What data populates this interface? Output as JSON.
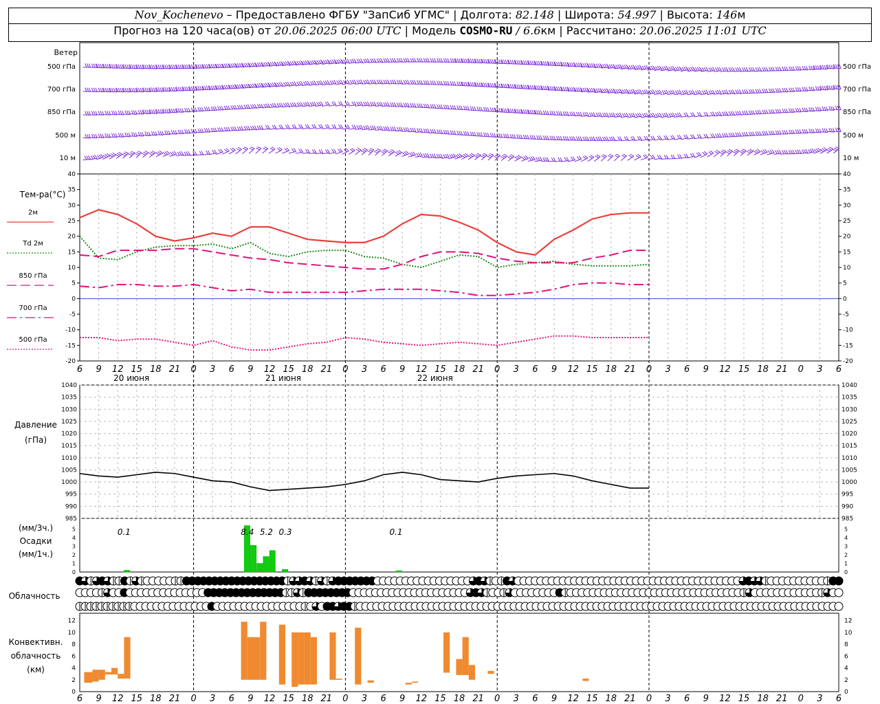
{
  "header": {
    "station": "Nov_Kochenevo",
    "provider": " – Предоставлено ФГБУ \"ЗапСиб УГМС\" | Долгота: ",
    "lon": "82.148",
    "lat_label": " | Широта: ",
    "lat": "54.997",
    "alt_label": " | Высота: ",
    "alt": "146",
    "alt_unit": "м",
    "forecast_prefix": "Прогноз на 120 часа(ов) от ",
    "forecast_time": "20.06.2025 06:00 UTC",
    "model_prefix": " | Модель ",
    "model": "COSMO-RU",
    "model_res": " / 6.6",
    "model_res_unit": "км",
    "calc_prefix": " | Рассчитано: ",
    "calc_time": "20.06.2025 11:01 UTC"
  },
  "chart_data": [
    {
      "type": "wind-barbs",
      "title": "Ветер",
      "levels": [
        "500 гПа",
        "700 гПа",
        "850 гПа",
        "500 м",
        "10  м"
      ],
      "color": "#7b2ad9"
    },
    {
      "type": "line",
      "title": "Тем-ра(°C)",
      "ylim": [
        -20,
        40
      ],
      "yticks": [
        40,
        35,
        30,
        25,
        20,
        15,
        10,
        5,
        0,
        -5,
        -10,
        -15,
        -20
      ],
      "x": [
        6,
        9,
        12,
        15,
        18,
        21,
        24,
        27,
        30,
        33,
        36,
        39,
        42,
        45,
        48,
        51,
        54,
        57,
        60,
        63,
        66,
        69,
        72,
        75,
        78,
        81,
        84,
        87,
        90,
        93,
        96,
        99,
        102,
        105,
        108,
        111,
        114,
        117,
        120,
        123,
        126
      ],
      "series": [
        {
          "name": "2м",
          "color": "#e8403a",
          "style": "solid",
          "values": [
            26,
            28.5,
            27,
            24,
            20,
            18.5,
            19.5,
            21,
            20,
            23,
            23,
            21,
            19,
            18.5,
            18,
            18,
            20,
            24,
            27,
            26.5,
            24.5,
            22,
            18,
            15,
            14,
            19,
            22,
            25.5,
            27,
            27.5,
            27.5
          ]
        },
        {
          "name": "Td  2м",
          "color": "#1a8c1a",
          "style": "dotted",
          "values": [
            20,
            13,
            12.5,
            15,
            16.5,
            17,
            17,
            17.5,
            16,
            18,
            14.5,
            13.5,
            15,
            15.5,
            15.5,
            13.5,
            13,
            11,
            10,
            12,
            14,
            13.5,
            10,
            11,
            11.5,
            12,
            11,
            10.5,
            10.5,
            10.5,
            11
          ]
        },
        {
          "name": "850 гПа",
          "color": "#e0107a",
          "style": "dashed",
          "values": [
            14,
            13.5,
            15.5,
            15.5,
            15.5,
            16,
            16,
            15,
            14,
            13,
            12.5,
            11.5,
            11,
            10.5,
            10,
            9.5,
            9.5,
            11,
            13.5,
            15,
            15,
            14.5,
            13,
            12,
            11.5,
            11.5,
            11.5,
            13,
            14,
            15.5,
            15.5
          ]
        },
        {
          "name": "700 гПа",
          "color": "#e0107a",
          "style": "dashdot",
          "values": [
            4,
            3.5,
            4.5,
            4.5,
            4,
            4,
            4.5,
            3.5,
            2.5,
            3,
            2,
            2,
            2,
            2,
            2,
            2.5,
            3,
            3,
            3,
            2.5,
            2,
            1,
            1,
            1.5,
            2,
            3,
            4.5,
            5,
            5,
            4.5,
            4.5
          ]
        },
        {
          "name": "500 гПа",
          "color": "#e0107a",
          "style": "dotted",
          "values": [
            -12.5,
            -12.5,
            -13.5,
            -13,
            -13,
            -14,
            -15,
            -13.5,
            -15.5,
            -16.5,
            -16.5,
            -15.5,
            -14.5,
            -14,
            -12.5,
            -13,
            -14,
            -14.5,
            -15,
            -14.5,
            -14,
            -14.5,
            -15,
            -14,
            -13,
            -12,
            -12,
            -12.5,
            -12.5,
            -12.5,
            -12.5
          ]
        }
      ],
      "x_ticks": [
        "6",
        "9",
        "12",
        "15",
        "18",
        "21",
        "0",
        "3",
        "6",
        "9",
        "12",
        "15",
        "18",
        "21",
        "0",
        "3",
        "6",
        "9",
        "12",
        "15",
        "18",
        "21",
        "0",
        "3",
        "6",
        "9",
        "12"
      ],
      "day_labels": [
        "20 июня",
        "21 июня",
        "22 июня"
      ]
    },
    {
      "type": "line",
      "title": "Давление",
      "unit": "(гПа)",
      "ylim": [
        985,
        1040
      ],
      "yticks": [
        1040,
        1035,
        1030,
        1025,
        1020,
        1015,
        1010,
        1005,
        1000,
        995,
        990,
        985
      ],
      "series": [
        {
          "name": "Давление",
          "color": "#000000",
          "values": [
            1003.5,
            1002.5,
            1002,
            1003,
            1004,
            1003.5,
            1002,
            1000.5,
            1000,
            998,
            996.5,
            997,
            997.5,
            998,
            999,
            1000.5,
            1003,
            1004,
            1003,
            1001,
            1000.5,
            1000,
            1001.5,
            1002.5,
            1003,
            1003.5,
            1002.5,
            1000.5,
            999,
            997.5,
            997.5
          ]
        }
      ]
    },
    {
      "type": "bar",
      "title": "Осадки",
      "unit_3h": "(мм/3ч.)",
      "unit_1h": "(мм/1ч.)",
      "ylim": [
        0,
        6
      ],
      "yticks": [
        5,
        4,
        3,
        2,
        1,
        0
      ],
      "color": "#11cc11",
      "bars": [
        {
          "x": 13,
          "value": 0.2
        },
        {
          "x": 32,
          "value": 5.4
        },
        {
          "x": 33,
          "value": 3.1
        },
        {
          "x": 34,
          "value": 1.0
        },
        {
          "x": 35,
          "value": 1.8
        },
        {
          "x": 36,
          "value": 2.5
        },
        {
          "x": 38,
          "value": 0.3
        },
        {
          "x": 56,
          "value": 0.15
        }
      ],
      "labels_3h": [
        {
          "x": 13,
          "text": "0.1"
        },
        {
          "x": 32.5,
          "text": "8.4"
        },
        {
          "x": 35.5,
          "text": "5.2"
        },
        {
          "x": 38.5,
          "text": "0.3"
        },
        {
          "x": 56,
          "text": "0.1"
        }
      ]
    },
    {
      "type": "table",
      "title": "Облачность",
      "rows": [
        [
          4,
          3,
          2,
          3,
          4,
          3,
          2,
          2,
          4,
          2,
          3,
          2,
          0,
          0,
          0,
          0,
          0,
          2,
          2,
          4,
          4,
          4,
          4,
          4,
          4,
          4,
          4,
          4,
          4,
          4,
          4,
          4,
          4,
          4,
          4,
          4,
          4,
          2,
          3,
          3,
          4,
          3,
          2,
          3,
          2,
          3,
          4,
          4,
          4,
          4,
          4,
          4,
          4,
          0,
          0,
          0,
          0,
          0,
          0,
          0,
          0,
          0,
          0,
          0,
          0,
          0,
          0,
          0,
          0,
          0,
          3,
          4,
          3,
          2,
          0,
          2,
          4,
          3,
          0,
          0,
          0,
          0,
          0,
          0,
          0,
          0,
          0,
          0,
          0,
          0,
          0,
          0,
          0,
          0,
          0,
          0,
          0,
          0,
          0,
          0,
          0,
          0,
          0,
          0,
          0,
          0,
          0,
          0,
          0,
          0,
          0,
          0,
          0,
          0,
          0,
          0,
          0,
          0,
          3,
          4,
          3,
          3,
          2,
          0,
          0,
          0,
          0,
          0,
          0,
          0,
          0,
          0,
          0,
          2,
          4,
          4
        ],
        [
          0,
          0,
          0,
          0,
          2,
          3,
          0,
          0,
          4,
          0,
          0,
          0,
          0,
          0,
          0,
          0,
          0,
          0,
          0,
          0,
          0,
          0,
          0,
          4,
          4,
          4,
          4,
          4,
          4,
          4,
          4,
          4,
          4,
          4,
          4,
          4,
          4,
          2,
          2,
          3,
          2,
          4,
          4,
          4,
          4,
          4,
          4,
          4,
          4,
          0,
          0,
          0,
          0,
          0,
          0,
          0,
          0,
          0,
          0,
          0,
          0,
          0,
          0,
          0,
          0,
          0,
          0,
          0,
          0,
          0,
          3,
          4,
          3,
          2,
          0,
          0,
          2,
          3,
          0,
          0,
          0,
          0,
          0,
          0,
          0,
          0,
          4,
          2,
          0,
          0,
          0,
          0,
          0,
          0,
          0,
          0,
          0,
          0,
          0,
          0,
          0,
          0,
          0,
          0,
          0,
          0,
          0,
          0,
          0,
          0,
          0,
          0,
          0,
          0,
          0,
          0,
          0,
          0,
          0,
          2,
          3,
          0,
          0,
          0,
          0,
          0,
          0,
          0,
          0,
          0,
          0,
          0,
          0,
          2,
          3,
          0,
          0
        ],
        [
          2,
          2,
          2,
          2,
          2,
          2,
          2,
          2,
          2,
          2,
          0,
          0,
          0,
          0,
          0,
          0,
          0,
          0,
          0,
          0,
          0,
          0,
          0,
          0,
          4,
          0,
          0,
          0,
          0,
          0,
          0,
          0,
          0,
          0,
          0,
          0,
          0,
          0,
          0,
          0,
          0,
          2,
          0,
          3,
          0,
          4,
          4,
          3,
          4,
          4,
          2,
          0,
          0,
          0,
          0,
          0,
          0,
          0,
          0,
          0,
          0,
          0,
          0,
          0,
          0,
          0,
          0,
          0,
          0,
          0,
          0,
          0,
          0,
          0,
          0,
          0,
          0,
          0,
          0,
          0,
          0,
          0,
          0,
          0,
          0,
          0,
          0,
          0,
          0,
          0,
          0,
          0,
          0,
          0,
          0,
          0,
          0,
          0,
          0,
          0,
          0,
          0,
          0,
          0,
          0,
          0,
          0,
          0,
          0,
          0,
          0,
          0,
          0,
          0,
          0,
          0,
          0,
          0,
          0,
          0,
          0,
          0,
          0,
          0,
          0,
          0,
          0,
          0,
          0,
          0,
          0,
          0,
          0,
          0,
          0,
          0,
          0,
          0,
          0
        ]
      ]
    },
    {
      "type": "bar",
      "title": "Конвективн.",
      "title2": "облачность",
      "unit": "(км)",
      "ylim": [
        0,
        13
      ],
      "yticks": [
        12,
        10,
        8,
        6,
        4,
        2,
        0
      ],
      "color": "#f08a30",
      "bars": [
        {
          "x0": 6.7,
          "x1": 8,
          "bottom": 1.5,
          "top": 3.3
        },
        {
          "x0": 8,
          "x1": 9,
          "bottom": 1.7,
          "top": 3.7
        },
        {
          "x0": 9,
          "x1": 10,
          "bottom": 2.0,
          "top": 3.7
        },
        {
          "x0": 10,
          "x1": 11,
          "bottom": 2.9,
          "top": 3.3
        },
        {
          "x0": 11,
          "x1": 12,
          "bottom": 2.9,
          "top": 4.0
        },
        {
          "x0": 12,
          "x1": 13,
          "bottom": 2.2,
          "top": 3.0
        },
        {
          "x0": 13,
          "x1": 14,
          "bottom": 2.2,
          "top": 9.2
        },
        {
          "x0": 31.5,
          "x1": 32.5,
          "bottom": 2.0,
          "top": 11.8
        },
        {
          "x0": 32.5,
          "x1": 33.5,
          "bottom": 2.0,
          "top": 9.2
        },
        {
          "x0": 33.5,
          "x1": 34.5,
          "bottom": 2.0,
          "top": 9.2
        },
        {
          "x0": 34.5,
          "x1": 35.5,
          "bottom": 2.0,
          "top": 11.8
        },
        {
          "x0": 37.5,
          "x1": 38.5,
          "bottom": 1.2,
          "top": 11.3
        },
        {
          "x0": 39.5,
          "x1": 40.5,
          "bottom": 0.8,
          "top": 10.0
        },
        {
          "x0": 40.5,
          "x1": 41.5,
          "bottom": 1.2,
          "top": 10.0
        },
        {
          "x0": 41.5,
          "x1": 42.5,
          "bottom": 1.2,
          "top": 10.0
        },
        {
          "x0": 42.5,
          "x1": 43.5,
          "bottom": 1.2,
          "top": 9.2
        },
        {
          "x0": 45.5,
          "x1": 46.5,
          "bottom": 2.0,
          "top": 10.0
        },
        {
          "x0": 46.5,
          "x1": 47.5,
          "bottom": 2.0,
          "top": 2.2
        },
        {
          "x0": 49.5,
          "x1": 50.5,
          "bottom": 1.2,
          "top": 10.8
        },
        {
          "x0": 51.5,
          "x1": 52.5,
          "bottom": 1.5,
          "top": 1.9
        },
        {
          "x0": 57.5,
          "x1": 58.5,
          "bottom": 1.2,
          "top": 1.5
        },
        {
          "x0": 58.5,
          "x1": 59.5,
          "bottom": 1.5,
          "top": 1.7
        },
        {
          "x0": 63.5,
          "x1": 64.5,
          "bottom": 3.2,
          "top": 10.0
        },
        {
          "x0": 65.5,
          "x1": 66.5,
          "bottom": 2.8,
          "top": 5.5
        },
        {
          "x0": 66.5,
          "x1": 67.5,
          "bottom": 2.8,
          "top": 9.2
        },
        {
          "x0": 67.5,
          "x1": 68.5,
          "bottom": 2.0,
          "top": 4.5
        },
        {
          "x0": 70.5,
          "x1": 71.5,
          "bottom": 3.0,
          "top": 3.5
        },
        {
          "x0": 85.5,
          "x1": 86.5,
          "bottom": 1.8,
          "top": 2.2
        }
      ]
    }
  ]
}
